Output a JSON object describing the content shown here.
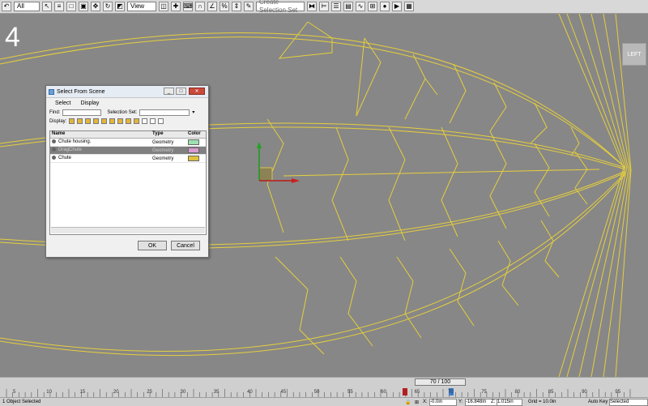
{
  "toolbar": {
    "filter_value": "All",
    "view_value": "View",
    "selection_set_placeholder": "Create Selection Set"
  },
  "viewport": {
    "number_label": "4",
    "viewcube_label": "LEFT"
  },
  "dialog": {
    "title": "Select From Scene",
    "menu": [
      "Select",
      "Display"
    ],
    "find_label": "Find:",
    "selection_set_label": "Selection Set:",
    "display_label": "Display:",
    "columns": {
      "name": "Name",
      "type": "Type",
      "color": "Color"
    },
    "rows": [
      {
        "name": "Chute housing.",
        "type": "Geometry",
        "color": "#9fe0b0"
      },
      {
        "name": "DragChute",
        "type": "Geometry",
        "color": "#d99ad0"
      },
      {
        "name": "Chute",
        "type": "Geometry",
        "color": "#e0c23a"
      }
    ],
    "ok_label": "OK",
    "cancel_label": "Cancel"
  },
  "timeline": {
    "frame_readout": "70 / 100",
    "ticks": [
      "5",
      "10",
      "15",
      "20",
      "25",
      "30",
      "35",
      "40",
      "45",
      "50",
      "55",
      "60",
      "65",
      "70",
      "75",
      "80",
      "85",
      "90",
      "95"
    ]
  },
  "status": {
    "selection_text": "1 Object Selected",
    "x_label": "X:",
    "x_value": "-0.0in",
    "y_label": "Y:",
    "y_value": "-16.848in",
    "z_label": "Z:",
    "z_value": "1.015in",
    "grid_text": "Grid = 10.0in",
    "autokey_label": "Auto Key",
    "selected_value": "Selected"
  },
  "colors": {
    "wire": "#e6cf3c",
    "viewport_bg": "#878787"
  }
}
